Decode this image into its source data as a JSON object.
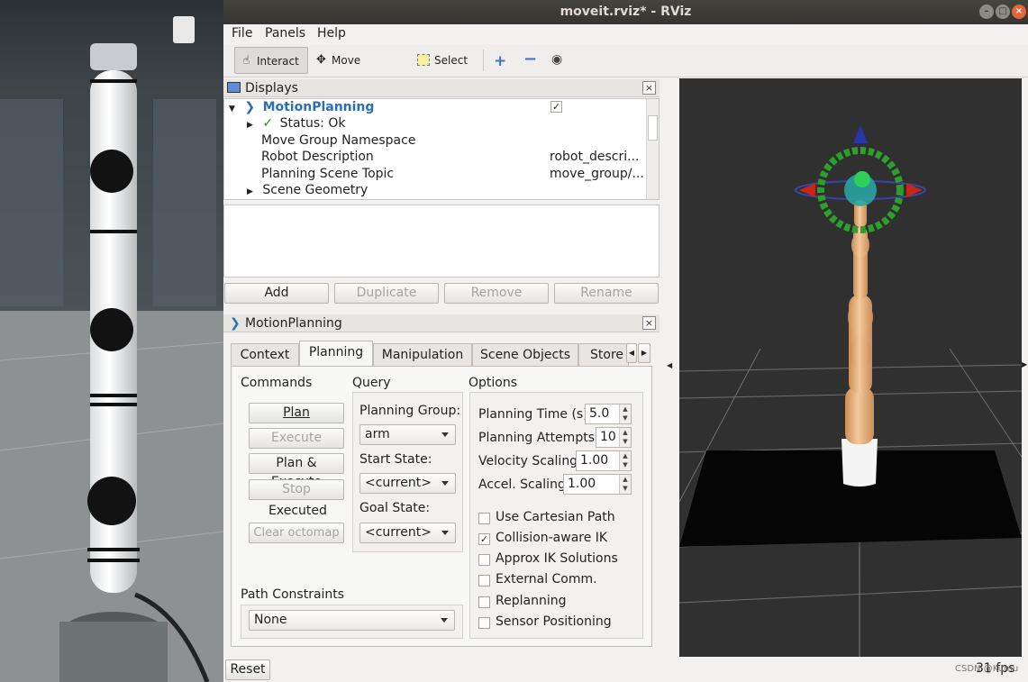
{
  "window": {
    "title": "moveit.rviz* - RViz"
  },
  "menu": {
    "file": "File",
    "panels": "Panels",
    "help": "Help"
  },
  "toolbar": {
    "interact": "Interact",
    "move_camera": "Move Camera",
    "select": "Select"
  },
  "displays": {
    "title": "Displays",
    "rows": [
      {
        "label": "MotionPlanning",
        "value": ""
      },
      {
        "label": "Status: Ok",
        "value": ""
      },
      {
        "label": "Move Group Namespace",
        "value": ""
      },
      {
        "label": "Robot Description",
        "value": "robot_descri..."
      },
      {
        "label": "Planning Scene Topic",
        "value": "move_group/..."
      },
      {
        "label": "Scene Geometry",
        "value": ""
      }
    ],
    "buttons": {
      "add": "Add",
      "duplicate": "Duplicate",
      "remove": "Remove",
      "rename": "Rename"
    }
  },
  "motion_planning": {
    "title": "MotionPlanning",
    "tabs": [
      "Context",
      "Planning",
      "Manipulation",
      "Scene Objects",
      "Store"
    ],
    "commands": {
      "title": "Commands",
      "plan": "Plan",
      "execute": "Execute",
      "plan_execute": "Plan & Execute",
      "stop": "Stop",
      "status": "Executed",
      "clear_octomap": "Clear octomap"
    },
    "query": {
      "title": "Query",
      "planning_group_label": "Planning Group:",
      "planning_group": "arm",
      "start_state_label": "Start State:",
      "start_state": "<current>",
      "goal_state_label": "Goal State:",
      "goal_state": "<current>"
    },
    "options": {
      "title": "Options",
      "planning_time_label": "Planning Time (s):",
      "planning_time": "5.0",
      "planning_attempts_label": "Planning Attempts:",
      "planning_attempts": "10",
      "velocity_scaling_label": "Velocity Scaling:",
      "velocity_scaling": "1.00",
      "accel_scaling_label": "Accel. Scaling:",
      "accel_scaling": "1.00",
      "checkboxes": [
        {
          "label": "Use Cartesian Path",
          "checked": false
        },
        {
          "label": "Collision-aware IK",
          "checked": true
        },
        {
          "label": "Approx IK Solutions",
          "checked": false
        },
        {
          "label": "External Comm.",
          "checked": false
        },
        {
          "label": "Replanning",
          "checked": false
        },
        {
          "label": "Sensor Positioning",
          "checked": false
        }
      ]
    },
    "path_constraints": {
      "label": "Path Constraints",
      "value": "None"
    }
  },
  "status": {
    "reset": "Reset",
    "fps": "31 fps",
    "watermark": "CSDN @Kumu"
  },
  "colors": {
    "link_blue": "#2a6fb8",
    "robot_orange": "#e8b483",
    "ring_green": "#2e9e2e",
    "view_bg": "#303030"
  }
}
